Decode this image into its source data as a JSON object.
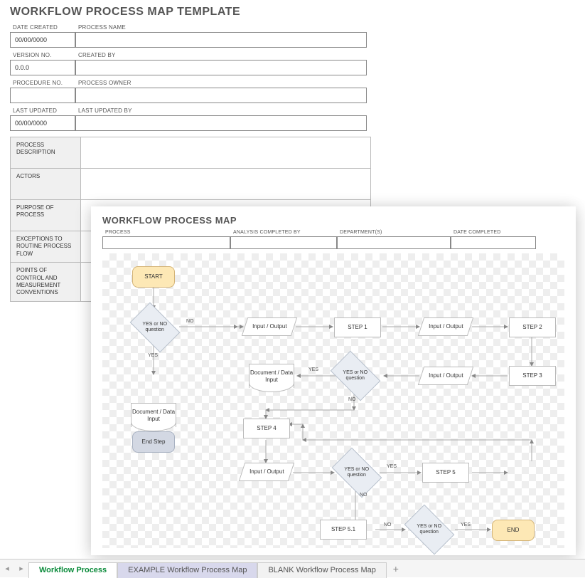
{
  "header": {
    "title": "WORKFLOW PROCESS MAP TEMPLATE"
  },
  "meta": {
    "date_created_lbl": "DATE CREATED",
    "date_created": "00/00/0000",
    "process_name_lbl": "PROCESS NAME",
    "process_name": "",
    "version_lbl": "VERSION NO.",
    "version": "0.0.0",
    "created_by_lbl": "CREATED BY",
    "created_by": "",
    "procedure_no_lbl": "PROCEDURE NO.",
    "procedure_no": "",
    "process_owner_lbl": "PROCESS OWNER",
    "process_owner": "",
    "last_updated_lbl": "LAST UPDATED",
    "last_updated": "00/00/0000",
    "last_updated_by_lbl": "LAST UPDATED BY",
    "last_updated_by": ""
  },
  "desc": {
    "r0": "PROCESS DESCRIPTION",
    "r1": "ACTORS",
    "r2": "PURPOSE OF PROCESS",
    "r3": "EXCEPTIONS TO ROUTINE PROCESS FLOW",
    "r4": "POINTS OF CONTROL AND MEASUREMENT CONVENTIONS"
  },
  "wpm": {
    "title": "WORKFLOW PROCESS MAP",
    "process_lbl": "PROCESS",
    "process": "",
    "analysis_lbl": "ANALYSIS COMPLETED BY",
    "analysis": "",
    "dept_lbl": "DEPARTMENT(S)",
    "dept": "",
    "date_completed_lbl": "DATE COMPLETED",
    "date_completed": ""
  },
  "flow": {
    "start": "START",
    "q1": "YES or NO question",
    "io1": "Input / Output",
    "s1": "STEP 1",
    "io2": "Input / Output",
    "s2": "STEP 2",
    "s3": "STEP 3",
    "io3": "Input / Output",
    "q2": "YES or NO question",
    "doc2": "Document / Data Input",
    "doc1": "Document / Data Input",
    "endstep": "End Step",
    "s4": "STEP 4",
    "io4": "Input / Output",
    "q3": "YES or NO question",
    "s5": "STEP 5",
    "s51": "STEP 5.1",
    "q4": "YES or NO question",
    "end": "END",
    "yes": "YES",
    "no": "NO"
  },
  "tabs": {
    "t0": "Workflow Process",
    "t1": "EXAMPLE Workflow Process Map",
    "t2": "BLANK Workflow Process Map"
  }
}
